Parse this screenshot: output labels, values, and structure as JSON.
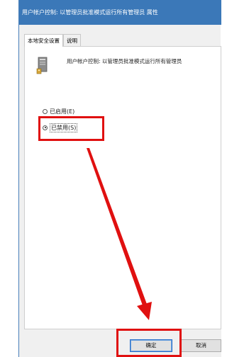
{
  "window": {
    "title": "用户帐户控制: 以管理员批准模式运行所有管理员 属性"
  },
  "tabs": [
    {
      "label": "本地安全设置",
      "active": true
    },
    {
      "label": "说明",
      "active": false
    }
  ],
  "policy": {
    "icon": "policy-server-icon",
    "title": "用户帐户控制: 以管理员批准模式运行所有管理员"
  },
  "options": {
    "enabled_label": "已启用(E)",
    "disabled_label": "已禁用(S)",
    "selected": "disabled"
  },
  "buttons": {
    "ok_label": "确定",
    "cancel_label": "取消"
  },
  "annotations": {
    "highlight_color": "#e01010"
  }
}
